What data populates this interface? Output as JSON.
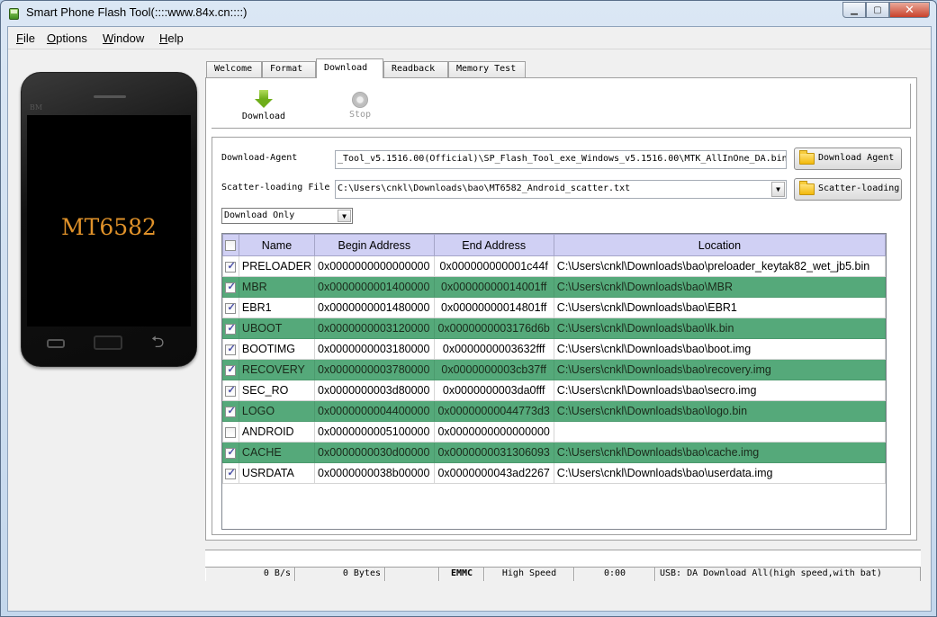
{
  "window": {
    "title": "Smart Phone Flash Tool(::::www.84x.cn::::)",
    "controls": {
      "minimize": "▁",
      "maximize": "▢",
      "close": "✕"
    }
  },
  "menu": [
    {
      "label": "File",
      "mnemonic": "F",
      "rest": "ile"
    },
    {
      "label": "Options",
      "mnemonic": "O",
      "rest": "ptions"
    },
    {
      "label": "Window",
      "mnemonic": "W",
      "rest": "indow"
    },
    {
      "label": "Help",
      "mnemonic": "H",
      "rest": "elp"
    }
  ],
  "phone": {
    "brand": "BM",
    "model": "MT6582",
    "back_glyph": "⮌"
  },
  "tabs": [
    {
      "label": "Welcome",
      "active": false
    },
    {
      "label": "Format",
      "active": false
    },
    {
      "label": "Download",
      "active": true
    },
    {
      "label": "Readback",
      "active": false
    },
    {
      "label": "Memory Test",
      "active": false
    }
  ],
  "toolbar": {
    "download_label": "Download",
    "stop_label": "Stop"
  },
  "download_agent": {
    "label": "Download-Agent",
    "value": "_Tool_v5.1516.00(Official)\\SP_Flash_Tool_exe_Windows_v5.1516.00\\MTK_AllInOne_DA.bin",
    "button": "Download Agent"
  },
  "scatter": {
    "label": "Scatter-loading File",
    "value": "C:\\Users\\cnkl\\Downloads\\bao\\MT6582_Android_scatter.txt",
    "button": "Scatter-loading"
  },
  "mode": {
    "selected": "Download Only"
  },
  "table": {
    "columns": [
      "Name",
      "Begin Address",
      "End Address",
      "Location"
    ],
    "header_checked": false,
    "rows": [
      {
        "checked": true,
        "highlight": false,
        "name": "PRELOADER",
        "begin": "0x0000000000000000",
        "end": "0x000000000001c44f",
        "location": "C:\\Users\\cnkl\\Downloads\\bao\\preloader_keytak82_wet_jb5.bin"
      },
      {
        "checked": true,
        "highlight": true,
        "name": "MBR",
        "begin": "0x0000000001400000",
        "end": "0x00000000014001ff",
        "location": "C:\\Users\\cnkl\\Downloads\\bao\\MBR"
      },
      {
        "checked": true,
        "highlight": false,
        "name": "EBR1",
        "begin": "0x0000000001480000",
        "end": "0x00000000014801ff",
        "location": "C:\\Users\\cnkl\\Downloads\\bao\\EBR1"
      },
      {
        "checked": true,
        "highlight": true,
        "name": "UBOOT",
        "begin": "0x0000000003120000",
        "end": "0x0000000003176d6b",
        "location": "C:\\Users\\cnkl\\Downloads\\bao\\lk.bin"
      },
      {
        "checked": true,
        "highlight": false,
        "name": "BOOTIMG",
        "begin": "0x0000000003180000",
        "end": "0x0000000003632fff",
        "location": "C:\\Users\\cnkl\\Downloads\\bao\\boot.img"
      },
      {
        "checked": true,
        "highlight": true,
        "name": "RECOVERY",
        "begin": "0x0000000003780000",
        "end": "0x0000000003cb37ff",
        "location": "C:\\Users\\cnkl\\Downloads\\bao\\recovery.img"
      },
      {
        "checked": true,
        "highlight": false,
        "name": "SEC_RO",
        "begin": "0x0000000003d80000",
        "end": "0x0000000003da0fff",
        "location": "C:\\Users\\cnkl\\Downloads\\bao\\secro.img"
      },
      {
        "checked": true,
        "highlight": true,
        "name": "LOGO",
        "begin": "0x0000000004400000",
        "end": "0x00000000044773d3",
        "location": "C:\\Users\\cnkl\\Downloads\\bao\\logo.bin"
      },
      {
        "checked": false,
        "highlight": false,
        "name": "ANDROID",
        "begin": "0x0000000005100000",
        "end": "0x0000000000000000",
        "location": ""
      },
      {
        "checked": true,
        "highlight": true,
        "name": "CACHE",
        "begin": "0x0000000030d00000",
        "end": "0x0000000031306093",
        "location": "C:\\Users\\cnkl\\Downloads\\bao\\cache.img"
      },
      {
        "checked": true,
        "highlight": false,
        "name": "USRDATA",
        "begin": "0x0000000038b00000",
        "end": "0x0000000043ad2267",
        "location": "C:\\Users\\cnkl\\Downloads\\bao\\userdata.img"
      }
    ]
  },
  "progress": {
    "percent": 0
  },
  "status": {
    "speed": "0 B/s",
    "bytes": "0 Bytes",
    "blank": "",
    "storage": "EMMC",
    "mode": "High Speed",
    "time": "0:00",
    "connection": "USB: DA Download All(high speed,with bat)"
  },
  "colors": {
    "row_highlight": "#55a97a",
    "header_bg": "#d0d0f4",
    "model_text": "#e0922a"
  }
}
